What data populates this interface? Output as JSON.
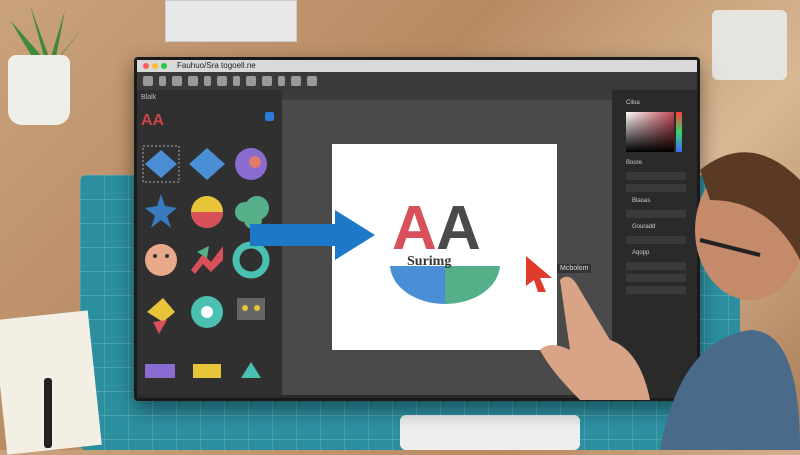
{
  "window": {
    "title": "Fauhuo/Sra togoell.ne"
  },
  "left_panel": {
    "header": "Blalk",
    "logo_text": "AA",
    "shapes": [
      "diamond-selected",
      "blue-diamond",
      "purple-circle",
      "blue-star",
      "yellow-red-circle",
      "green-cloud",
      "peach-face",
      "red-green-zigzag",
      "teal-ring",
      "arrow-cluster",
      "teal-pie",
      "gray-robot",
      "purple-shape",
      "yellow-shape",
      "teal-shape"
    ]
  },
  "canvas": {
    "logo_letter_1": "A",
    "logo_letter_2": "A",
    "logo_subtitle": "Surimg",
    "colors": {
      "letter_1": "#d8505a",
      "letter_2": "#4a4a4a",
      "bowl_left": "#4a8ed6",
      "bowl_right": "#55b08a"
    }
  },
  "right_panel": {
    "tabs": [
      "Clloa",
      "Boore"
    ],
    "label_1": "Blaoas",
    "label_2": "Gouradd",
    "label_3": "Aqopp"
  },
  "tag": "Mcbolom",
  "icons": {
    "arrow": "blue-right-arrow-icon",
    "pointer": "red-pointer-icon"
  }
}
